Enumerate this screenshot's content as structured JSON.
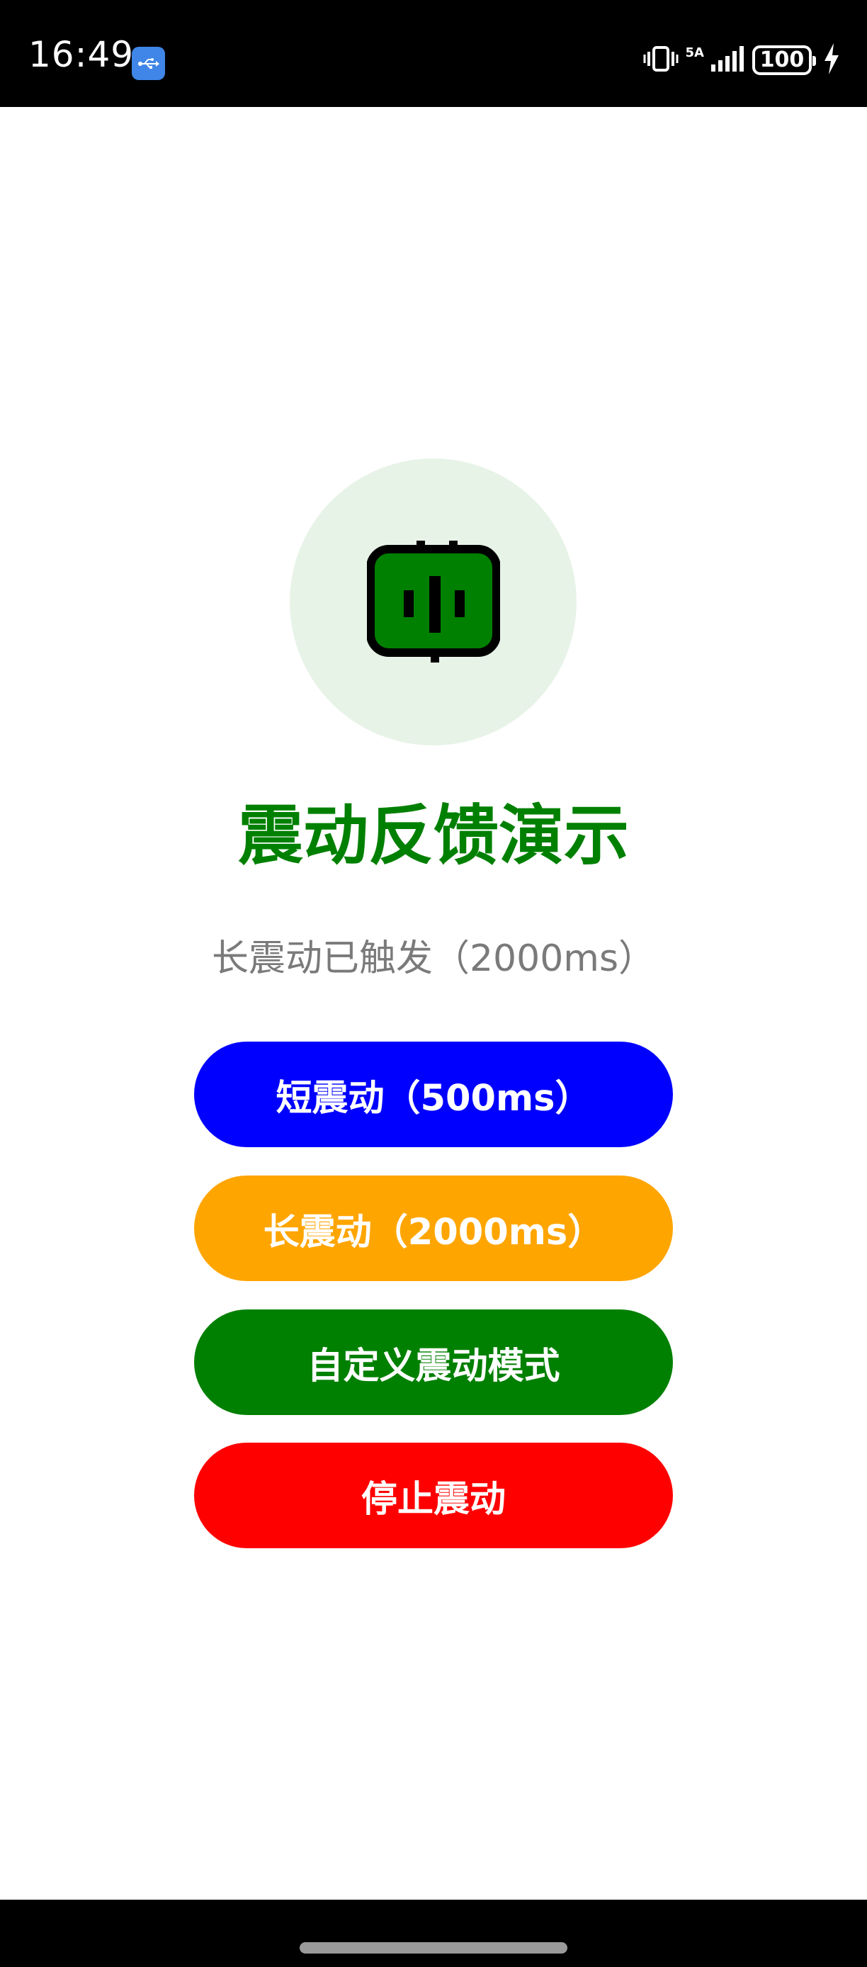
{
  "status_bar": {
    "time": "16:49",
    "network_label": "5A",
    "battery_level": "100"
  },
  "main": {
    "title": "震动反馈演示",
    "status_message": "长震动已触发（2000ms）",
    "buttons": [
      {
        "label": "短震动（500ms）",
        "color": "#0000ff"
      },
      {
        "label": "长震动（2000ms）",
        "color": "#ffa500"
      },
      {
        "label": "自定义震动模式",
        "color": "#008000"
      },
      {
        "label": "停止震动",
        "color": "#ff0000"
      }
    ]
  },
  "colors": {
    "accent": "#008000",
    "icon_background": "#e8f3e8",
    "status_text": "#7a7a7a"
  },
  "icons": {
    "hero": "vibration-icon",
    "status_usb": "usb-icon",
    "status_vibrate": "vibrate-mode-icon",
    "status_signal": "signal-icon",
    "status_battery": "battery-icon",
    "status_charging": "charging-icon"
  }
}
